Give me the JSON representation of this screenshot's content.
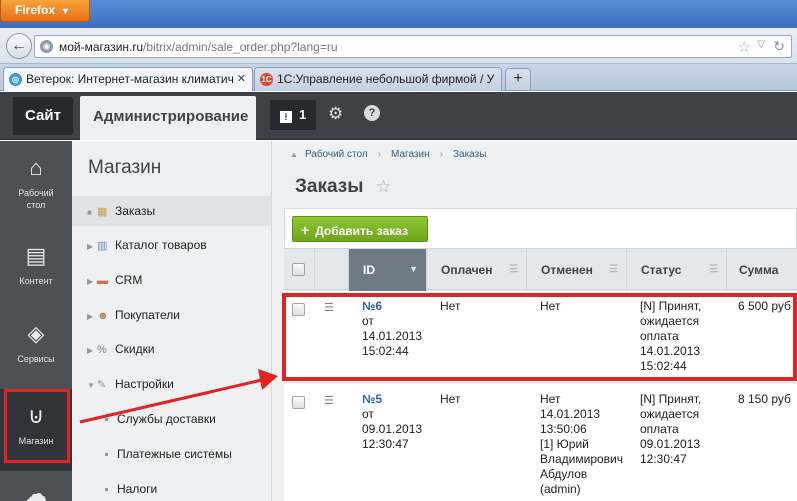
{
  "browser": {
    "menu_button": "Firefox",
    "back_icon": "back-arrow-icon",
    "url_domain": "мой-магазин.ru",
    "url_path": "/bitrix/admin/sale_order.php?lang=ru",
    "tabs": [
      {
        "label": "Ветерок: Интернет-магазин климатич",
        "icon": "site-favicon"
      },
      {
        "label": "1С:Управление небольшой фирмой / У",
        "icon": "1c-favicon"
      }
    ],
    "new_tab": "+"
  },
  "panel": {
    "site_label": "Сайт",
    "admin_label": "Администрирование",
    "notify_count": "1"
  },
  "iconbar": {
    "items": [
      {
        "label_1": "Рабочий",
        "label_2": "стол",
        "icon": "home-icon"
      },
      {
        "label_1": "Контент",
        "label_2": "",
        "icon": "document-icon"
      },
      {
        "label_1": "Сервисы",
        "label_2": "",
        "icon": "layers-icon"
      },
      {
        "label_1": "Магазин",
        "label_2": "",
        "icon": "basket-icon"
      }
    ]
  },
  "menu": {
    "title": "Магазин",
    "items": [
      {
        "label": "Заказы"
      },
      {
        "label": "Каталог товаров"
      },
      {
        "label": "CRM"
      },
      {
        "label": "Покупатели"
      },
      {
        "label": "Скидки"
      },
      {
        "label": "Настройки"
      }
    ],
    "sub_items": [
      {
        "label": "Службы доставки"
      },
      {
        "label": "Платежные системы"
      },
      {
        "label": "Налоги"
      }
    ]
  },
  "main": {
    "breadcrumbs": [
      "Рабочий стол",
      "Магазин",
      "Заказы"
    ],
    "title": "Заказы",
    "add_button": "Добавить заказ",
    "columns": [
      "ID",
      "Оплачен",
      "Отменен",
      "Статус",
      "Сумма"
    ],
    "rows": [
      {
        "id": "№6",
        "date_prefix": "от",
        "date": "14.01.2013",
        "time": "15:02:44",
        "paid": "Нет",
        "canceled_1": "Нет",
        "canceled_2": "",
        "canceled_3": "",
        "canceled_4": "",
        "canceled_5": "",
        "canceled_6": "",
        "status_1": "[N] Принят,",
        "status_2": "ожидается",
        "status_3": "оплата",
        "status_4": "14.01.2013",
        "status_5": "15:02:44",
        "sum": "6 500 руб"
      },
      {
        "id": "№5",
        "date_prefix": "от",
        "date": "09.01.2013",
        "time": "12:30:47",
        "paid": "Нет",
        "canceled_1": "Нет",
        "canceled_2": "14.01.2013",
        "canceled_3": "13:50:06",
        "canceled_4": "[1] Юрий",
        "canceled_5": "Владимирович",
        "canceled_6": "Абдулов",
        "canceled_7": "(admin)",
        "status_1": "[N] Принят,",
        "status_2": "ожидается",
        "status_3": "оплата",
        "status_4": "09.01.2013",
        "status_5": "12:30:47",
        "sum": "8 150 руб"
      }
    ]
  },
  "colors": {
    "highlight": "#e32222",
    "add_button": "#7cb32a",
    "link": "#2a66b8"
  }
}
